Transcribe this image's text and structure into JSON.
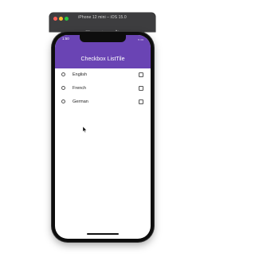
{
  "simulator": {
    "title": "iPhone 12 mini – iOS 15.0",
    "tools": [
      "screenshot-icon",
      "home-icon",
      "rotate-icon"
    ],
    "traffic_light_colors": [
      "#ff5f57",
      "#febc2e",
      "#28c840"
    ]
  },
  "status_bar": {
    "time": "1:50",
    "icons": [
      "wifi-icon",
      "battery-icon"
    ]
  },
  "app_bar": {
    "title": "Checkbox ListTile",
    "color": "#6a44b4"
  },
  "list": {
    "items": [
      {
        "label": "English",
        "checked": false
      },
      {
        "label": "French",
        "checked": false
      },
      {
        "label": "German",
        "checked": false
      }
    ]
  }
}
